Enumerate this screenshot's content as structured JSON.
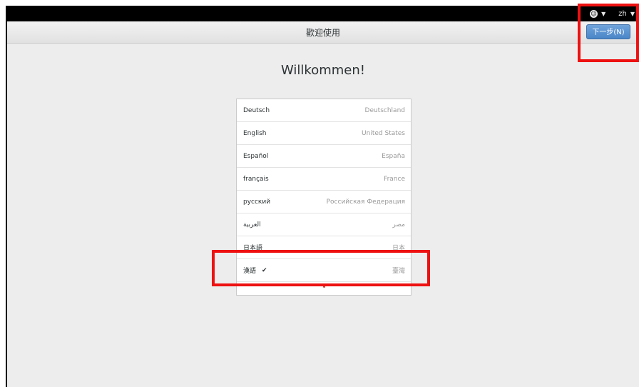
{
  "topbar": {
    "accessibility_icon": "accessibility-icon",
    "input_method": "zh"
  },
  "header": {
    "title": "歡迎使用",
    "next_label": "下一步(N)"
  },
  "main": {
    "welcome": "Willkommen!"
  },
  "languages": [
    {
      "name": "Deutsch",
      "region": "Deutschland",
      "selected": false
    },
    {
      "name": "English",
      "region": "United States",
      "selected": false
    },
    {
      "name": "Español",
      "region": "España",
      "selected": false
    },
    {
      "name": "français",
      "region": "France",
      "selected": false
    },
    {
      "name": "русский",
      "region": "Российская Федерация",
      "selected": false
    },
    {
      "name": "العربية",
      "region": "مصر",
      "selected": false
    },
    {
      "name": "日本語",
      "region": "日本",
      "selected": false
    },
    {
      "name": "漢語",
      "region": "臺灣",
      "selected": true
    }
  ],
  "colors": {
    "annotation": "#ee1111",
    "accent": "#4a86c8"
  }
}
